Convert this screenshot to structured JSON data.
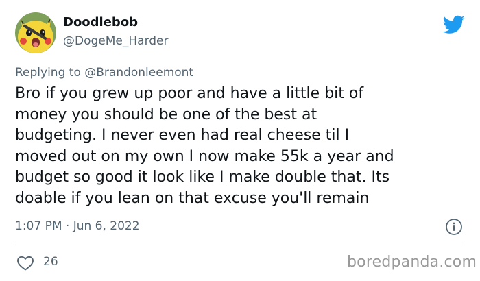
{
  "author": {
    "display_name": "Doodlebob",
    "handle": "@DogeMe_Harder",
    "avatar_icon": "pikachu-avatar"
  },
  "brand_icon": "twitter-bird-icon",
  "colors": {
    "twitter_blue": "#1d9bf0",
    "text_primary": "#0f1419",
    "text_secondary": "#536471",
    "avatar_yellow": "#f4d63a"
  },
  "reply": {
    "prefix": "Replying to ",
    "mention": "@Brandonleemont"
  },
  "tweet": {
    "text": "Bro if you grew up poor and have a little bit of\nmoney you should be one of the best at\nbudgeting.  I never even had real cheese til I\nmoved out on my own I now make 55k a year and\nbudget so good it look like I make double that. Its\ndoable if you lean on that excuse you'll remain",
    "timestamp": "1:07 PM · Jun 6, 2022"
  },
  "actions": {
    "like_icon": "heart-icon",
    "like_count": "26",
    "info_icon": "info-icon"
  },
  "watermark": "boredpanda.com"
}
